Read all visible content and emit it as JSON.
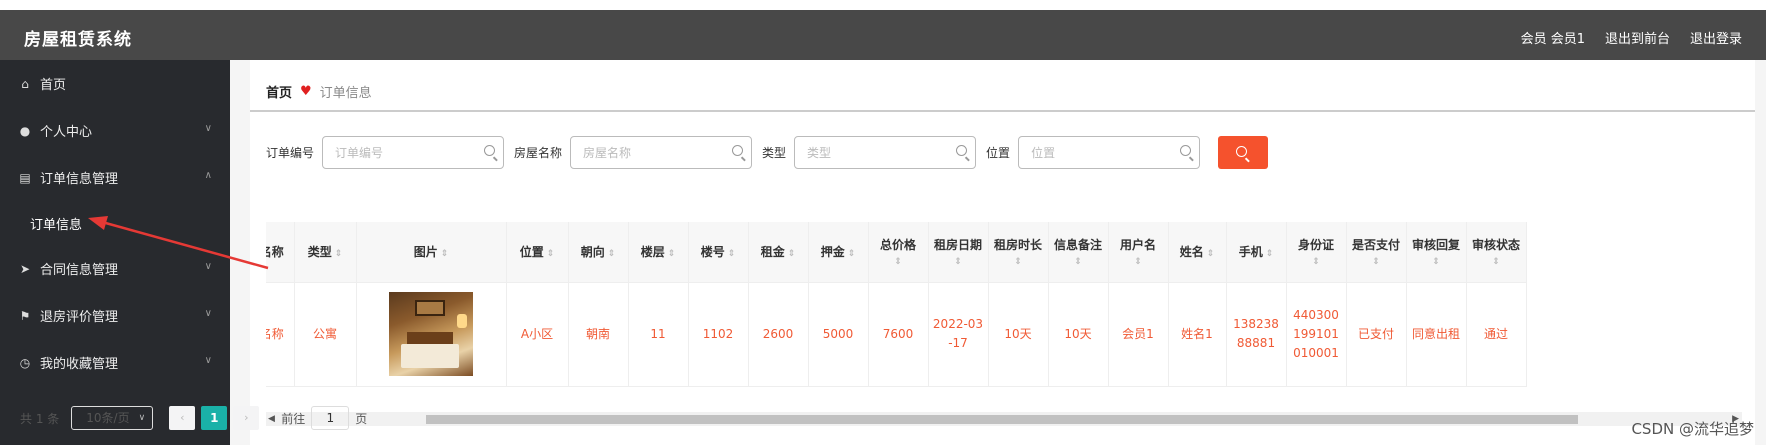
{
  "app": {
    "title": "房屋租赁系统"
  },
  "header": {
    "user": "会员 会员1",
    "to_front": "退出到前台",
    "logout": "退出登录"
  },
  "sidebar": {
    "items": [
      {
        "label": "首页",
        "icon": "home-icon",
        "chev": ""
      },
      {
        "label": "个人中心",
        "icon": "user-icon",
        "chev": "∨"
      },
      {
        "label": "订单信息管理",
        "icon": "chart-icon",
        "chev": "∧"
      },
      {
        "label": "订单信息",
        "icon": "",
        "chev": ""
      },
      {
        "label": "合同信息管理",
        "icon": "send-icon",
        "chev": "∨"
      },
      {
        "label": "退房评价管理",
        "icon": "flag-icon",
        "chev": "∨"
      },
      {
        "label": "我的收藏管理",
        "icon": "clock-icon",
        "chev": "∨"
      }
    ]
  },
  "breadcrumb": {
    "home": "首页",
    "heart": "♥",
    "current": "订单信息"
  },
  "search": {
    "fields": [
      {
        "label": "订单编号",
        "placeholder": "订单编号"
      },
      {
        "label": "房屋名称",
        "placeholder": "房屋名称"
      },
      {
        "label": "类型",
        "placeholder": "类型"
      },
      {
        "label": "位置",
        "placeholder": "位置"
      }
    ]
  },
  "table": {
    "headers": [
      "名称",
      "类型",
      "图片",
      "位置",
      "朝向",
      "楼层",
      "楼号",
      "租金",
      "押金",
      "总价格",
      "租房日期",
      "租房时长",
      "信息备注",
      "用户名",
      "姓名",
      "手机",
      "身份证",
      "是否支付",
      "审核回复",
      "审核状态"
    ],
    "sort_glyph": "⇕",
    "row": {
      "c0": "名称",
      "c1": "公寓",
      "c3": "A小区",
      "c4": "朝南",
      "c5": "11",
      "c6": "1102",
      "c7": "2600",
      "c8": "5000",
      "c9": "7600",
      "c10": "2022-03-17",
      "c11": "10天",
      "c12": "10天",
      "c13": "会员1",
      "c14": "姓名1",
      "c15": "13823888881",
      "c16": "440300199101010001",
      "c17": "已支付",
      "c18": "同意出租",
      "c19": "通过"
    }
  },
  "pager": {
    "total": "共 1 条",
    "size": "10条/页",
    "prev": "‹",
    "page": "1",
    "next": "›",
    "goto": "前往",
    "goto_val": "1",
    "unit": "页"
  },
  "watermark": "CSDN @流华追梦",
  "colors": {
    "accent": "#f5522d",
    "active_page": "#1ab1a8",
    "cell_text": "#f05a35",
    "sidebar": "#282a2e",
    "topbar": "#484848"
  }
}
